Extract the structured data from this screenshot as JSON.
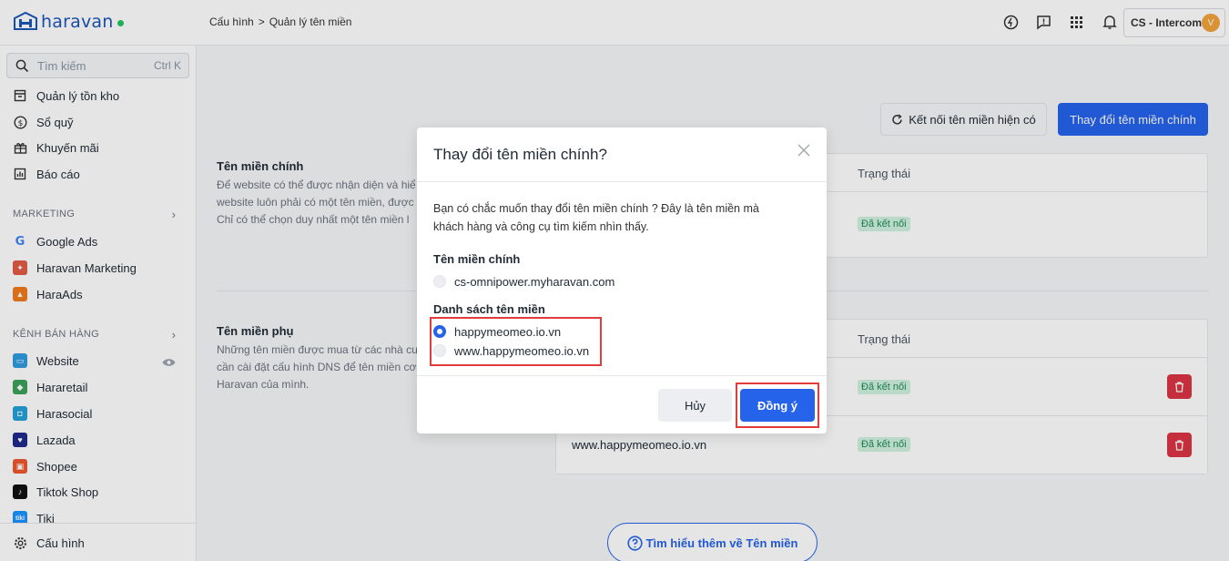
{
  "colors": {
    "primary": "#2563eb",
    "danger": "#dc3545",
    "success_bg": "#d1f2e0",
    "success_text": "#1f8a55",
    "highlight": "#e23b3b"
  },
  "header": {
    "brand": "haravan",
    "breadcrumb": [
      "Cấu hình",
      ">",
      "Quản lý tên miền"
    ],
    "icons": [
      "support-icon",
      "feedback-icon",
      "apps-grid-icon",
      "bell-icon"
    ],
    "store_name": "CS - Intercom",
    "avatar_initial": "V"
  },
  "sidebar": {
    "search_placeholder": "Tìm kiếm",
    "search_shortcut": "Ctrl K",
    "items_top": [
      {
        "label": "Quản lý tồn kho",
        "icon": "inventory-icon"
      },
      {
        "label": "Sổ quỹ",
        "icon": "cashbook-icon"
      },
      {
        "label": "Khuyến mãi",
        "icon": "gift-icon"
      },
      {
        "label": "Báo cáo",
        "icon": "report-icon"
      }
    ],
    "marketing_title": "MARKETING",
    "marketing_items": [
      {
        "label": "Google Ads",
        "icon": "google-icon"
      },
      {
        "label": "Haravan Marketing",
        "icon": "haravan-marketing-icon"
      },
      {
        "label": "HaraAds",
        "icon": "haraads-icon"
      }
    ],
    "sales_title": "KÊNH BÁN HÀNG",
    "sales_items": [
      {
        "label": "Website",
        "icon": "website-icon"
      },
      {
        "label": "Hararetail",
        "icon": "hararetail-icon"
      },
      {
        "label": "Harasocial",
        "icon": "harasocial-icon"
      },
      {
        "label": "Lazada",
        "icon": "lazada-icon"
      },
      {
        "label": "Shopee",
        "icon": "shopee-icon"
      },
      {
        "label": "Tiktok Shop",
        "icon": "tiktok-icon"
      },
      {
        "label": "Tiki",
        "icon": "tiki-icon"
      }
    ],
    "footer_label": "Cấu hình"
  },
  "main": {
    "connect_button": "Kết nối tên miền hiện có",
    "change_button": "Thay đổi tên miền chính",
    "primary_section": {
      "title": "Tên miền chính",
      "desc": [
        "Để website có thể được nhận diện và hiể",
        "website luôn phải có một tên miền, được",
        "Chỉ có thể chọn duy nhất một tên miền l"
      ],
      "status_header": "Trạng thái",
      "status": "Đã kết nối"
    },
    "secondary_section": {
      "title": "Tên miền phụ",
      "desc": [
        "Những tên miền được mua từ các nhà cu",
        "cần cài đặt cấu hình DNS để tên miền cơ",
        "Haravan của mình."
      ],
      "status_header": "Trạng thái",
      "rows": [
        {
          "domain": "",
          "status": "Đã kết nối"
        },
        {
          "domain": "www.happymeomeo.io.vn",
          "status": "Đã kết nối"
        }
      ]
    },
    "learn_more": "Tìm hiểu thêm về Tên miền"
  },
  "modal": {
    "title": "Thay đổi tên miền chính?",
    "desc_line1": "Bạn có chắc muốn thay đổi tên miền chính ? Đây là tên miền mà",
    "desc_line2": "khách hàng và công cụ tìm kiếm nhìn thấy.",
    "primary_label": "Tên miền chính",
    "primary_option": "cs-omnipower.myharavan.com",
    "list_label": "Danh sách tên miền",
    "options": [
      {
        "label": "happymeomeo.io.vn",
        "selected": true
      },
      {
        "label": "www.happymeomeo.io.vn",
        "selected": false
      }
    ],
    "cancel": "Hủy",
    "confirm": "Đồng ý"
  }
}
